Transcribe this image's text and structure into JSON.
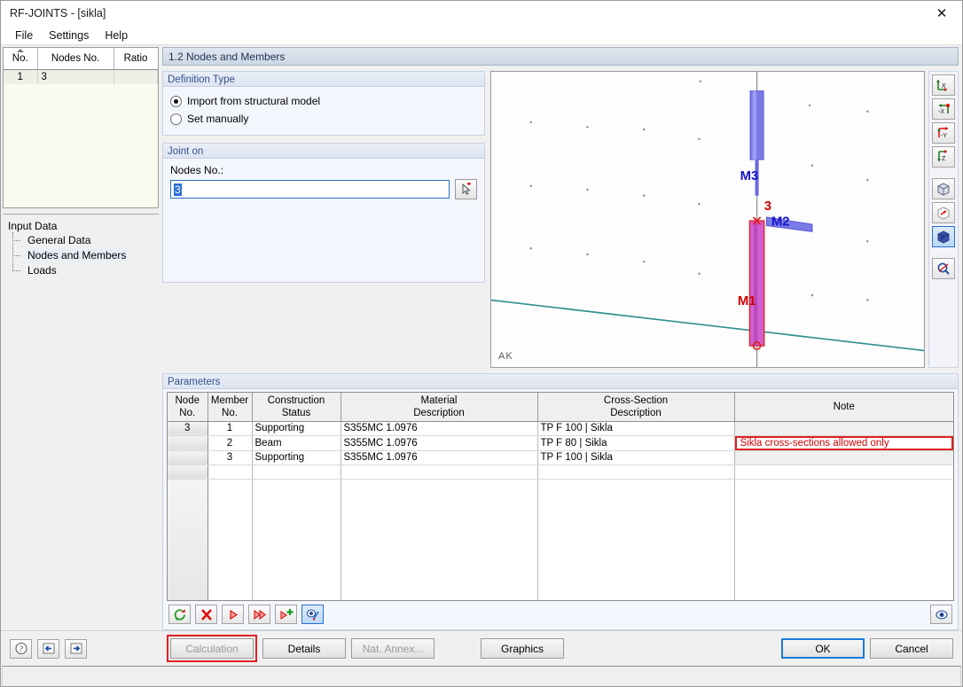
{
  "window": {
    "title": "RF-JOINTS - [sikla]",
    "close_label": "✕"
  },
  "menu": {
    "items": [
      {
        "label": "File"
      },
      {
        "label": "Settings"
      },
      {
        "label": "Help"
      }
    ]
  },
  "sidebar": {
    "table": {
      "headers": [
        "No.",
        "Nodes No.",
        "Ratio"
      ],
      "rows": [
        {
          "no": "1",
          "nodes_no": "3",
          "ratio": ""
        }
      ]
    },
    "tree": {
      "root": "Input Data",
      "items": [
        {
          "label": "General Data",
          "selected": false
        },
        {
          "label": "Nodes and Members",
          "selected": true
        },
        {
          "label": "Loads",
          "selected": false
        }
      ]
    }
  },
  "section": {
    "title": "1.2 Nodes and Members"
  },
  "definition_type": {
    "title": "Definition Type",
    "options": [
      {
        "label": "Import from structural model",
        "selected": true
      },
      {
        "label": "Set manually",
        "selected": false
      }
    ]
  },
  "joint_on": {
    "title": "Joint on",
    "field_label": "Nodes No.:",
    "value": "3",
    "pick_icon": "pick-node-icon"
  },
  "viewport": {
    "corner_label": "AK",
    "members": [
      {
        "label": "M3",
        "color": "#1515c8"
      },
      {
        "label": "M2",
        "color": "#1515c8"
      },
      {
        "label": "M1",
        "color": "#d00000"
      }
    ],
    "node_label": "3",
    "node_color": "#d00000"
  },
  "view_toolbar": {
    "buttons": [
      {
        "name": "view-x-icon",
        "selected": false
      },
      {
        "name": "view-minus-x-icon",
        "selected": false
      },
      {
        "name": "view-minus-y-icon",
        "selected": false
      },
      {
        "name": "view-z-icon",
        "selected": false
      },
      {
        "name": "view-isometric-icon",
        "selected": false
      },
      {
        "name": "view-wireframe-icon",
        "selected": false
      },
      {
        "name": "view-rendered-icon",
        "selected": true
      },
      {
        "name": "zoom-all-icon",
        "selected": false
      }
    ]
  },
  "parameters": {
    "title": "Parameters",
    "headers": [
      {
        "line1": "Node",
        "line2": "No."
      },
      {
        "line1": "Member",
        "line2": "No."
      },
      {
        "line1": "Construction",
        "line2": "Status"
      },
      {
        "line1": "Material",
        "line2": "Description"
      },
      {
        "line1": "Cross-Section",
        "line2": "Description"
      },
      {
        "line1": "Note",
        "line2": ""
      }
    ],
    "rows": [
      {
        "node_no": "3",
        "member_no": "1",
        "construction_status": "Supporting",
        "material": "S355MC 1.0976",
        "cross_section": "TP F 100 | Sikla",
        "note": "",
        "note_error": false
      },
      {
        "node_no": "",
        "member_no": "2",
        "construction_status": "Beam",
        "material": "S355MC 1.0976",
        "cross_section": "TP F 80 | Sikla",
        "note": "Sikla cross-sections allowed only",
        "note_error": true
      },
      {
        "node_no": "",
        "member_no": "3",
        "construction_status": "Supporting",
        "material": "S355MC 1.0976",
        "cross_section": "TP F 100 | Sikla",
        "note": "",
        "note_error": false
      }
    ],
    "toolbar": [
      {
        "name": "refresh-icon",
        "selected": false
      },
      {
        "name": "delete-icon",
        "selected": false
      },
      {
        "name": "next-icon",
        "selected": false
      },
      {
        "name": "fast-forward-icon",
        "selected": false
      },
      {
        "name": "add-icon",
        "selected": false
      },
      {
        "name": "visibility-edit-icon",
        "selected": true
      }
    ],
    "eye_button": {
      "name": "eye-icon"
    }
  },
  "footer": {
    "icons": [
      {
        "name": "help-icon"
      },
      {
        "name": "previous-dialog-icon"
      },
      {
        "name": "next-dialog-icon"
      }
    ],
    "calculation": {
      "label": "Calculation",
      "disabled": true,
      "highlighted": true
    },
    "details": {
      "label": "Details",
      "disabled": false
    },
    "nat_annex": {
      "label": "Nat. Annex...",
      "disabled": true
    },
    "graphics": {
      "label": "Graphics",
      "disabled": false
    },
    "ok": {
      "label": "OK",
      "focused": true
    },
    "cancel": {
      "label": "Cancel",
      "focused": false
    }
  },
  "colors": {
    "error_red": "#e02020",
    "accent_blue": "#2a6fd4",
    "member_blue": "#6a6ae0",
    "member_magenta": "#cc44cc",
    "ground_teal": "#2f8f8f"
  }
}
